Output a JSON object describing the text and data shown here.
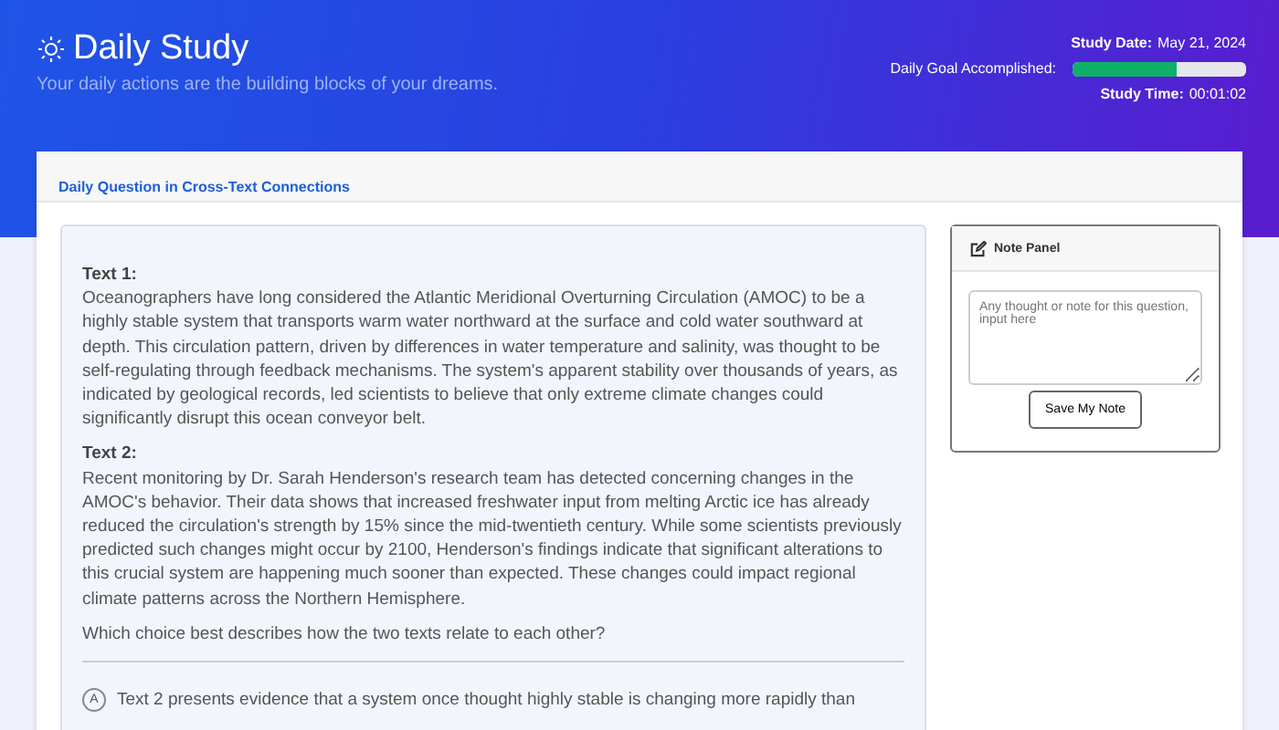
{
  "header": {
    "title": "Daily Study",
    "subtitle": "Your daily actions are the building blocks of your dreams.",
    "study_date_label": "Study Date:",
    "study_date": "May 21, 2024",
    "goal_label": "Daily Goal Accomplished:",
    "goal": {
      "level": 0.6
    },
    "study_time_label": "Study Time:",
    "study_time": "00:01:02"
  },
  "card": {
    "title": "Daily Question in Cross-Text Connections"
  },
  "passage": {
    "texts": [
      {
        "heading": "Text 1:",
        "body": "Oceanographers have long considered the Atlantic Meridional Overturning Circulation (AMOC) to be a highly stable system that transports warm water northward at the surface and cold water southward at depth. This circulation pattern, driven by differences in water temperature and salinity, was thought to be self-regulating through feedback mechanisms. The system's apparent stability over thousands of years, as indicated by geological records, led scientists to believe that only extreme climate changes could significantly disrupt this ocean conveyor belt."
      },
      {
        "heading": "Text 2:",
        "body": "Recent monitoring by Dr. Sarah Henderson's research team has detected concerning changes in the AMOC's behavior. Their data shows that increased freshwater input from melting Arctic ice has already reduced the circulation's strength by 15% since the mid-twentieth century. While some scientists previously predicted such changes might occur by 2100, Henderson's findings indicate that significant alterations to this crucial system are happening much sooner than expected. These changes could impact regional climate patterns across the Northern Hemisphere."
      }
    ],
    "question": "Which choice best describes how the two texts relate to each other?",
    "choices": [
      {
        "letter": "A",
        "text": "Text 2 presents evidence that a system once thought highly stable is changing more rapidly than"
      }
    ]
  },
  "note_panel": {
    "title": "Note Panel",
    "placeholder": "Any thought or note for this question, input here",
    "button": "Save My Note"
  }
}
